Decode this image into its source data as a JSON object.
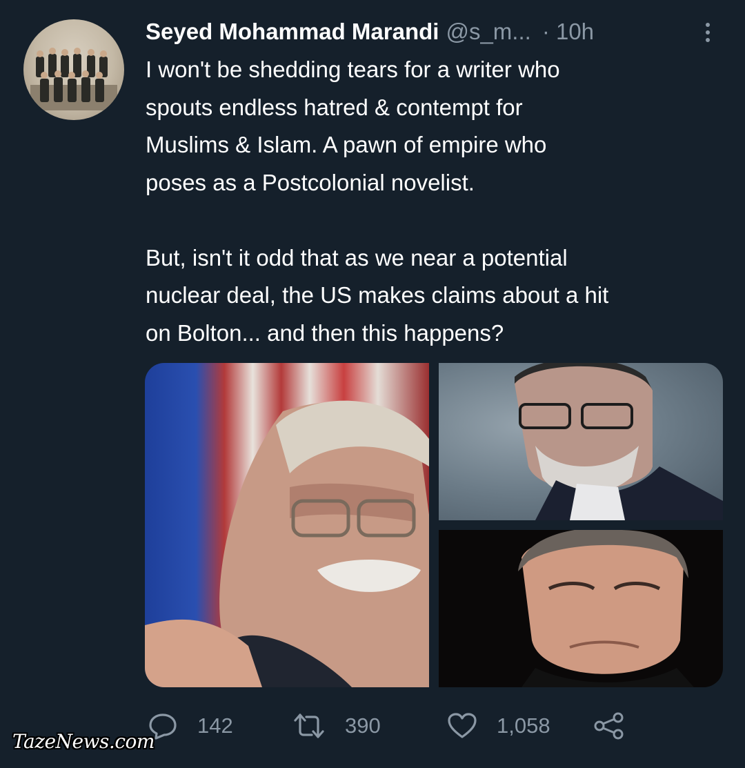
{
  "tweet": {
    "author_name": "Seyed Mohammad Marandi",
    "author_handle": "@s_m...",
    "timestamp": "· 10h",
    "text_paragraph_1": [
      "I won't be shedding tears for a writer who",
      "spouts endless hatred & contempt for",
      "Muslims & Islam. A pawn of empire who",
      "poses as a Postcolonial novelist."
    ],
    "text_paragraph_2": [
      "But, isn't it odd that as we near a potential",
      "nuclear deal, the US makes claims about a hit",
      "on Bolton... and then this happens?"
    ]
  },
  "actions": {
    "replies": "142",
    "retweets": "390",
    "likes": "1,058"
  },
  "icons": {
    "reply": "reply-icon",
    "retweet": "retweet-icon",
    "like": "heart-icon",
    "share": "share-icon",
    "more": "more-options-icon"
  },
  "colors": {
    "background": "#15202b",
    "text_primary": "#ffffff",
    "text_secondary": "#8b98a5"
  },
  "watermark": "TazeNews.com"
}
